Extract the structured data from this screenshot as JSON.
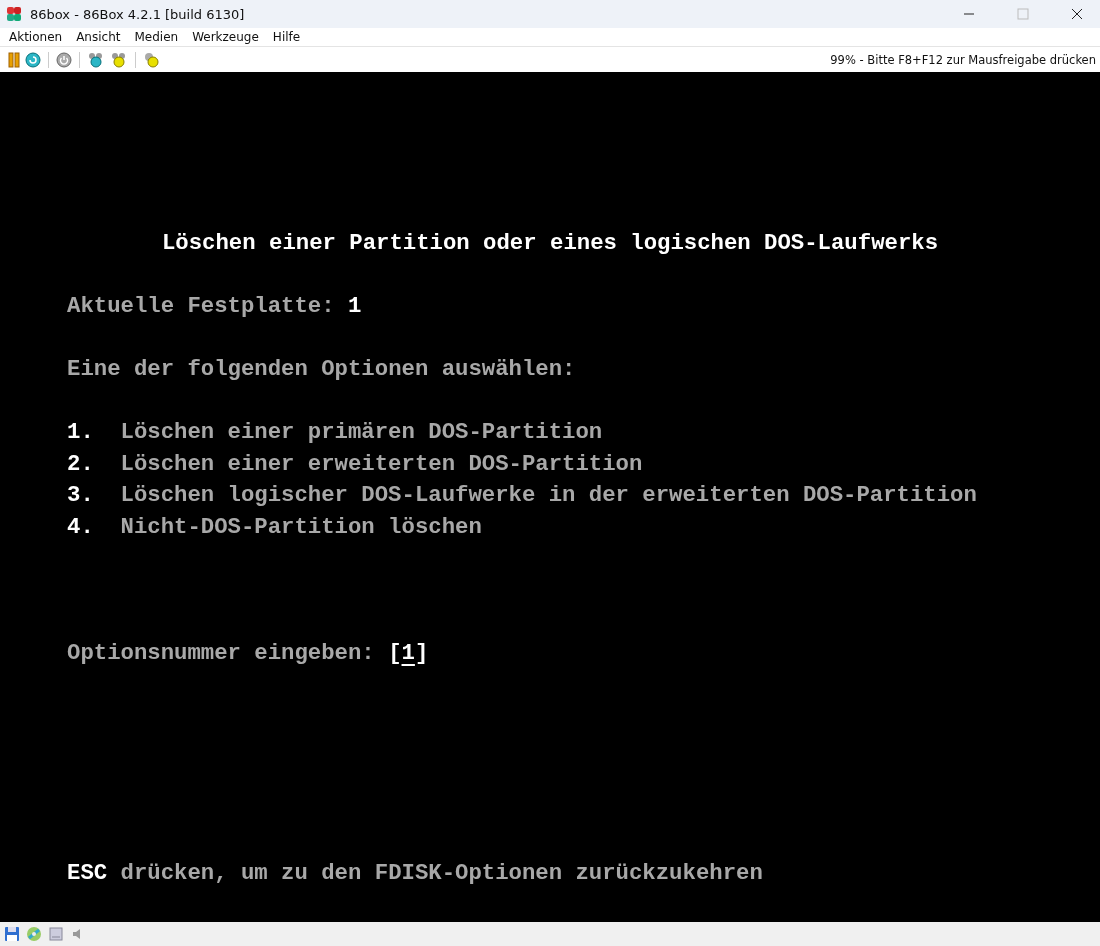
{
  "window": {
    "title": "86box - 86Box 4.2.1 [build 6130]"
  },
  "menu": [
    "Aktionen",
    "Ansicht",
    "Medien",
    "Werkzeuge",
    "Hilfe"
  ],
  "toolbar": {
    "status": "99% - Bitte F8+F12 zur Mausfreigabe drücken"
  },
  "screen": {
    "title": "Löschen einer Partition oder eines logischen DOS-Laufwerks",
    "current_disk_label": "Aktuelle Festplatte:",
    "current_disk": "1",
    "prompt": "Eine der folgenden Optionen auswählen:",
    "options": [
      {
        "number": "1.",
        "label": "Löschen einer primären DOS-Partition"
      },
      {
        "number": "2.",
        "label": "Löschen einer erweiterten DOS-Partition"
      },
      {
        "number": "3.",
        "label": "Löschen logischer DOS-Laufwerke in der erweiterten DOS-Partition"
      },
      {
        "number": "4.",
        "label": "Nicht-DOS-Partition löschen"
      }
    ],
    "input_label": "Optionsnummer eingeben:",
    "input_open": "[",
    "input_value": "1",
    "input_close": "]",
    "footer_key": "ESC",
    "footer_text": "drücken, um zu den FDISK-Optionen zurückzukehren"
  }
}
